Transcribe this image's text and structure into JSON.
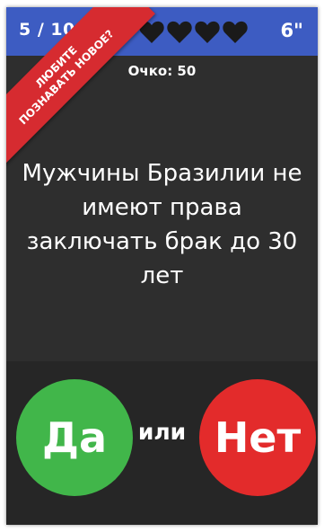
{
  "header": {
    "progress": "5 / 10",
    "lives": 4,
    "timer": "6\""
  },
  "ribbon": {
    "line1": "ЛЮБИТЕ",
    "line2": "ПОЗНАВАТЬ НОВОЕ?"
  },
  "score": "Очко: 50",
  "question": "Мужчины Бразилии не имеют права заключать брак до 30 лет",
  "answers": {
    "yes_label": "Да",
    "or_label": "или",
    "no_label": "Нет"
  },
  "icons": {
    "life": "heart-icon"
  },
  "colors": {
    "header": "#3d5cc2",
    "yes": "#41b64a",
    "no": "#e32b2b",
    "ribbon": "#d62b30",
    "background": "#2e2e2e"
  }
}
